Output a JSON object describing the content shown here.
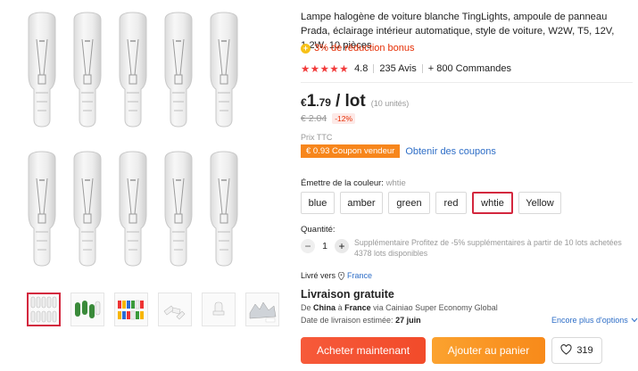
{
  "product": {
    "title": "Lampe halogène de voiture blanche TingLights, ampoule de panneau Prada, éclairage intérieur automatique, style de voiture, W2W, T5, 12V, 1.2W, 10 pièces",
    "bonus": "3% de réduction bonus",
    "rating": "4.8",
    "reviews": "235 Avis",
    "orders": "+ 800 Commandes"
  },
  "price": {
    "currency": "€",
    "integer": "1",
    "decimal": ".79",
    "unit": "/ lot",
    "qty_note": "(10 unités)",
    "old": "€ 2.04",
    "discount": "-12%",
    "tax_note": "Prix TTC"
  },
  "coupon": {
    "label": "€ 0.93 Coupon vendeur",
    "link": "Obtenir des coupons"
  },
  "color": {
    "label": "Émettre de la couleur:",
    "selected": "whtie",
    "options": [
      "blue",
      "amber",
      "green",
      "red",
      "whtie",
      "Yellow"
    ]
  },
  "quantity": {
    "label": "Quantité:",
    "minus": "−",
    "value": "1",
    "plus": "+",
    "note1": "Supplémentaire Profitez de -5% supplémentaires à partir de 10 lots achetées",
    "note2": "4378 lots disponibles"
  },
  "shipping": {
    "ship_to_label": "Livré vers",
    "country": "France",
    "free": "Livraison gratuite",
    "via_prefix": "De",
    "from": "China",
    "to_word": "à",
    "to": "France",
    "via_text": "via Cainiao Super Economy Global",
    "delivery_label": "Date de livraison estimée:",
    "delivery_date": "27 juin",
    "more_options": "Encore plus d'options"
  },
  "actions": {
    "buy": "Acheter maintenant",
    "cart": "Ajouter au panier",
    "wishlist_count": "319"
  },
  "colors_theme": {
    "accent_red": "#d3273e",
    "orange": "#f7861c",
    "link_blue": "#2e6ec7"
  },
  "icons": [
    "coin-icon",
    "star-icon",
    "pin-icon",
    "chevron-down-icon",
    "heart-icon"
  ]
}
